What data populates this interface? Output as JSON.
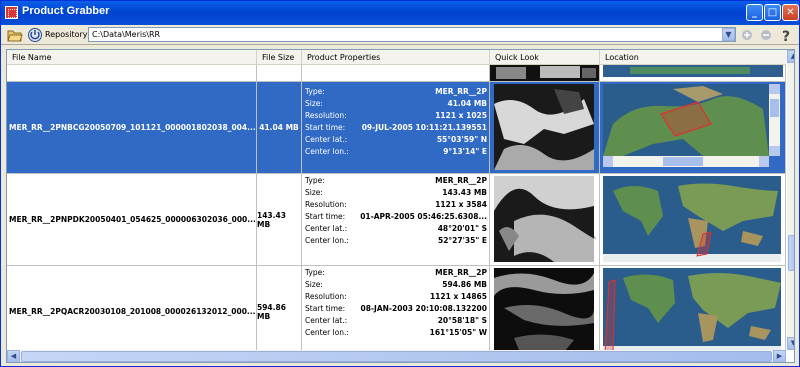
{
  "window": {
    "title": "Product Grabber"
  },
  "toolbar": {
    "repository_label": "Repository:",
    "repository_value": "C:\\Data\\Meris\\RR"
  },
  "columns": [
    "File Name",
    "File Size",
    "Product Properties",
    "Quick Look",
    "Location"
  ],
  "rows": [
    {
      "file_name": "MER_RR__2PNBCG20050709_101121_000001802038_004...",
      "file_size": "41.04 MB",
      "properties": [
        {
          "k": "Type:",
          "v": "MER_RR__2P"
        },
        {
          "k": "Size:",
          "v": "41.04 MB"
        },
        {
          "k": "Resolution:",
          "v": "1121 x 1025"
        },
        {
          "k": "Start time:",
          "v": "09-JUL-2005 10:11:21.139551"
        },
        {
          "k": "Center lat.:",
          "v": "55°03'59\" N"
        },
        {
          "k": "Center lon.:",
          "v": "9°13'14\" E"
        }
      ],
      "selected": true
    },
    {
      "file_name": "MER_RR__2PNPDK20050401_054625_000006302036_000...",
      "file_size": "143.43 MB",
      "properties": [
        {
          "k": "Type:",
          "v": "MER_RR__2P"
        },
        {
          "k": "Size:",
          "v": "143.43 MB"
        },
        {
          "k": "Resolution:",
          "v": "1121 x 3584"
        },
        {
          "k": "Start time:",
          "v": "01-APR-2005 05:46:25.6308..."
        },
        {
          "k": "Center lat.:",
          "v": "48°20'01\" S"
        },
        {
          "k": "Center lon.:",
          "v": "52°27'35\" E"
        }
      ],
      "selected": false
    },
    {
      "file_name": "MER_RR__2PQACR20030108_201008_000026132012_000...",
      "file_size": "594.86 MB",
      "properties": [
        {
          "k": "Type:",
          "v": "MER_RR__2P"
        },
        {
          "k": "Size:",
          "v": "594.86 MB"
        },
        {
          "k": "Resolution:",
          "v": "1121 x 14865"
        },
        {
          "k": "Start time:",
          "v": "08-JAN-2003 20:10:08.132200"
        },
        {
          "k": "Center lat.:",
          "v": "20°58'18\" S"
        },
        {
          "k": "Center lon.:",
          "v": "161°15'05\" W"
        }
      ],
      "selected": false
    }
  ],
  "icons": {
    "app": "app-icon",
    "open": "folder-open-icon",
    "repo": "repository-icon",
    "add": "add-icon",
    "remove": "remove-icon",
    "help": "help-icon"
  },
  "colors": {
    "selection": "#316AC5",
    "titlebar": "#0042CF",
    "footprint": "#E03030"
  }
}
